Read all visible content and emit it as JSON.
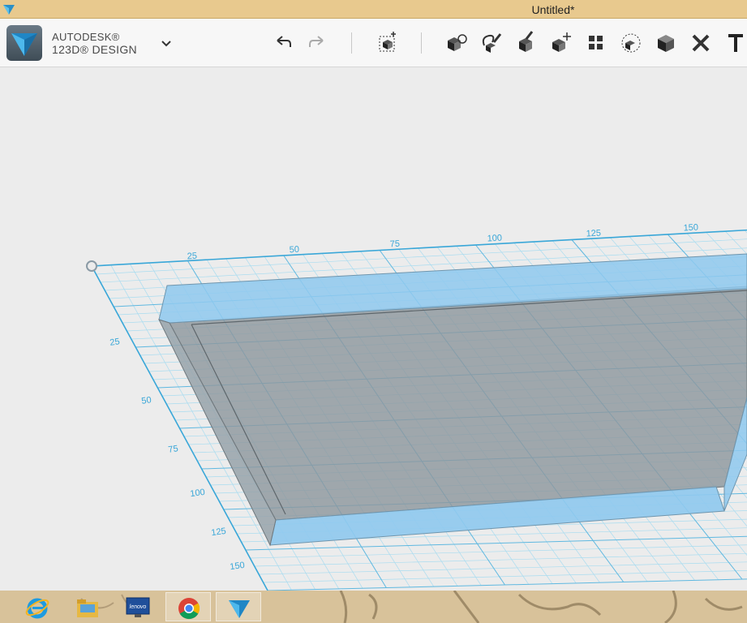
{
  "window": {
    "title": "Untitled*"
  },
  "brand": {
    "line1": "AUTODESK®",
    "line2": "123D® DESIGN"
  },
  "toolbar": {
    "icons": [
      "undo-icon",
      "redo-icon",
      "primitives-icon",
      "sketch-icon",
      "construct-icon",
      "modify-icon",
      "pattern-icon",
      "group-icon",
      "combine-icon",
      "measure-icon",
      "text-icon"
    ]
  },
  "grid": {
    "x_labels": [
      "25",
      "50",
      "75",
      "100",
      "125",
      "150"
    ],
    "y_labels": [
      "25",
      "50",
      "75",
      "100",
      "125",
      "150"
    ]
  },
  "taskbar": {
    "apps": [
      "internet-explorer-icon",
      "file-explorer-icon",
      "lenovo-icon",
      "chrome-icon",
      "123d-design-icon"
    ],
    "lenovo_text": "lenovo"
  },
  "colors": {
    "accent": "#3aa7d8",
    "title_bar": "#e8c98e",
    "grid_line": "#7cc6e6",
    "wall": "#8fc9ee",
    "floor": "#8e979d"
  }
}
